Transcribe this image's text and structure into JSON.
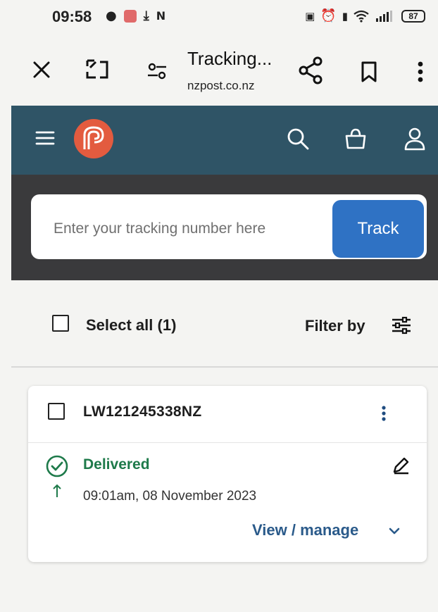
{
  "status_bar": {
    "time": "09:58",
    "battery": "87"
  },
  "browser": {
    "title": "Tracking...",
    "domain": "nzpost.co.nz"
  },
  "site": {
    "brand_color": "#2f5466",
    "search": {
      "placeholder": "Enter your tracking number here",
      "value": "",
      "button_label": "Track"
    }
  },
  "list_controls": {
    "select_all_label": "Select all (1)",
    "filter_label": "Filter by"
  },
  "parcel": {
    "tracking_number": "LW121245338NZ",
    "status": "Delivered",
    "status_color": "#1e7a4a",
    "status_time": "09:01am, 08 November 2023",
    "view_manage_label": "View / manage"
  }
}
